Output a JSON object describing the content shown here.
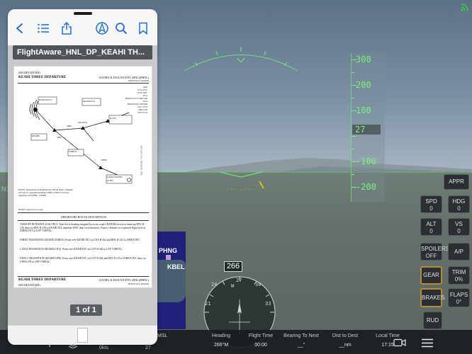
{
  "viewer": {
    "doc_title": "FlightAware_HNL_DP_KEAHI TH...",
    "page_indicator": "1 of 1",
    "toolbar": {
      "back": "chevron-left-icon",
      "outline": "list-icon",
      "share": "share-icon",
      "annotate": "pen-circle-icon",
      "search": "search-icon",
      "bookmark": "bookmark-icon"
    },
    "chart": {
      "header_left_1": "(KEAHI3.KEAHI)",
      "header_left_2": "KEAHI THREE DEPARTURE",
      "header_right_1": "DANIEL K INOUYE INTL (HNL)(PHNL)",
      "header_right_2": "HONOLULU, HAWAII",
      "comms": [
        "ATIS",
        "127.9 270.0",
        "CLNC DEL",
        "121.4",
        "HONOLULU GND CON",
        "121.9",
        "HONOLULU TOWER",
        "118.1 257.8",
        "DEP CON",
        "124.8 371.0"
      ],
      "fixes": [
        "HONOLULU",
        "MOKOLEA",
        "KEAHI",
        "JORDA",
        "UPOLU POINT",
        "(UPP)",
        "(SETZO)",
        "(LNY)"
      ],
      "altitudes": [
        "5000",
        "10000",
        "5000"
      ],
      "notes": "NOTE: Departures from Runways 26L/R must complete left turn to assigned heading within 2 NM of runway departure end (HNL 5 DME).",
      "chart_not_to_scale": "NOTE: Chart not to scale.",
      "route_desc_title": "DEPARTURE ROUTE DESCRIPTION",
      "takeoff_text": "TAKEOFF RUNWAYS 22/26 ONLY: Turn left to heading assigned by tower, expect RADAR vectors to intercept HNL R-138, then via HNL R-138 to KEAHI INT, maintain 5000', then via (transition). Expect clearance to requested flight level at JORDA INT or LNY VORTAC.",
      "jorda_text": "JORDA TRANSITION (KEAHI3.JORDA): From over KEAHI INT via LNY R-262 and HNL R-125 to JORDA INT.",
      "lanai_text": "LANAI TRANSITION (KEAHI3.LNY): From over KEAHI INT via LNY R-262 to LNY VORTAC.",
      "upolu_text": "UPOLU TRANSITION (KEAHI3.UPP): From over KEAHI INT via LNY R-262 and HNL R-125 to JORDA INT, then via UPP R-278 to UPP VORTAC.",
      "footer_left_1": "KEAHI THREE DEPARTURE",
      "footer_left_2": "(KEAHI3.KEAHI)",
      "footer_right_1": "DANIEL K INOUYE INTL (HNL)(PHNL)",
      "footer_right_2": "HONOLULU, HAWAII",
      "side_text": "PAC, 16 SEP 2017 to 12 OCT 2017"
    }
  },
  "hud": {
    "altitude_ticks": [
      "300",
      "200",
      "100",
      "-100",
      "-200"
    ],
    "current_altitude": "27",
    "heading": "266",
    "compass_labels": [
      "24",
      "27",
      "30",
      "W",
      "21",
      "33"
    ],
    "left_edge_label": "N1"
  },
  "map": {
    "label_1": "PHNG",
    "label_2": "KBEL"
  },
  "controls": {
    "appr": "APPR",
    "spd_label": "SPD",
    "spd_value": "0",
    "hdg_label": "HDG",
    "hdg_value": "0",
    "alt_label": "ALT",
    "alt_value": "0",
    "vs_label": "VS",
    "vs_value": "0",
    "spoilers_label": "SPOILERS",
    "spoilers_value": "OFF",
    "ap": "A/P",
    "gear": "GEAR",
    "trim_label": "TRIM",
    "trim_value": "0%",
    "brakes": "BRAKES",
    "flaps_label": "FLAPS",
    "flaps_value": "0°",
    "rud": "RUD"
  },
  "status": {
    "speed_value": "0kts",
    "vs_value": "27",
    "msl_label": "MSL",
    "heading_label": "Heading",
    "heading_value": "266°M",
    "flight_time_label": "Flight Time",
    "flight_time_value": "00:00",
    "bearing_label": "Bearing To Next",
    "bearing_value": "__°",
    "dist_label": "Dist to Dest",
    "dist_value": "__nm",
    "local_time_label": "Local Time",
    "local_time_value": "17:15"
  },
  "colors": {
    "hud_green": "#7cf07c",
    "ios_blue": "#1f6fe0",
    "gold_border": "#b58b3a"
  }
}
